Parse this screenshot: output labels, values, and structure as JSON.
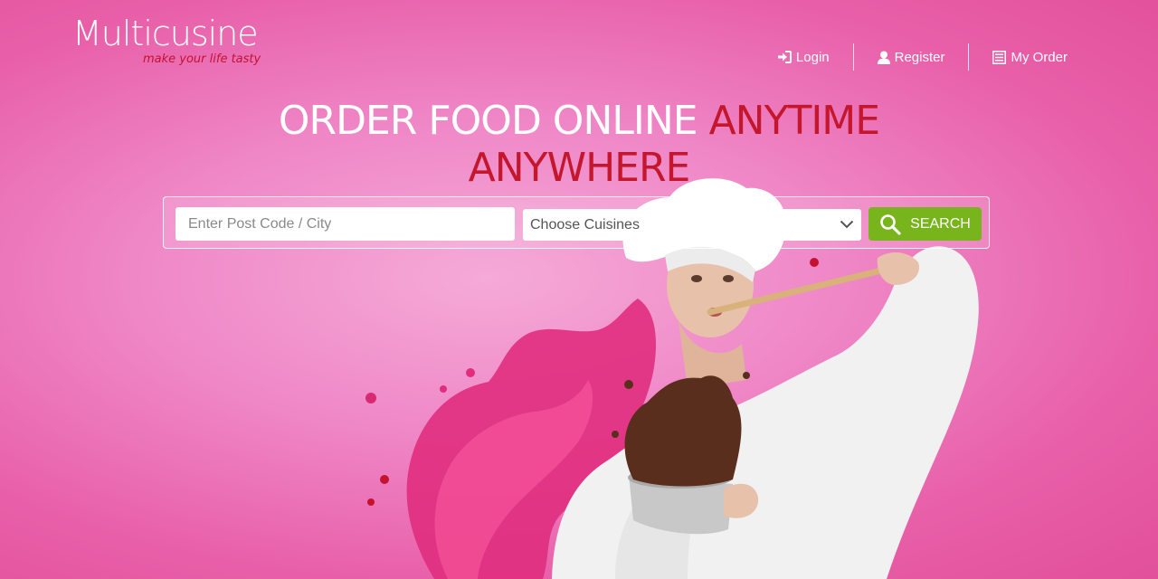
{
  "brand": {
    "name": "Multicusine",
    "tagline": "make your life tasty"
  },
  "nav": {
    "items": [
      {
        "label": "Login",
        "icon": "sign-in-icon"
      },
      {
        "label": "Register",
        "icon": "user-icon"
      },
      {
        "label": "My Order",
        "icon": "list-icon"
      }
    ]
  },
  "hero": {
    "headline_white": "ORDER FOOD ONLINE",
    "headline_red_1": "ANYTIME",
    "headline_red_2": "ANYWHERE"
  },
  "search": {
    "post_placeholder": "Enter Post Code / City",
    "cuisine_selected": "Choose Cuisines",
    "button_label": "SEARCH"
  },
  "colors": {
    "background": "#ef86c6",
    "accent_red": "#c4162c",
    "button_green": "#78b41c"
  }
}
